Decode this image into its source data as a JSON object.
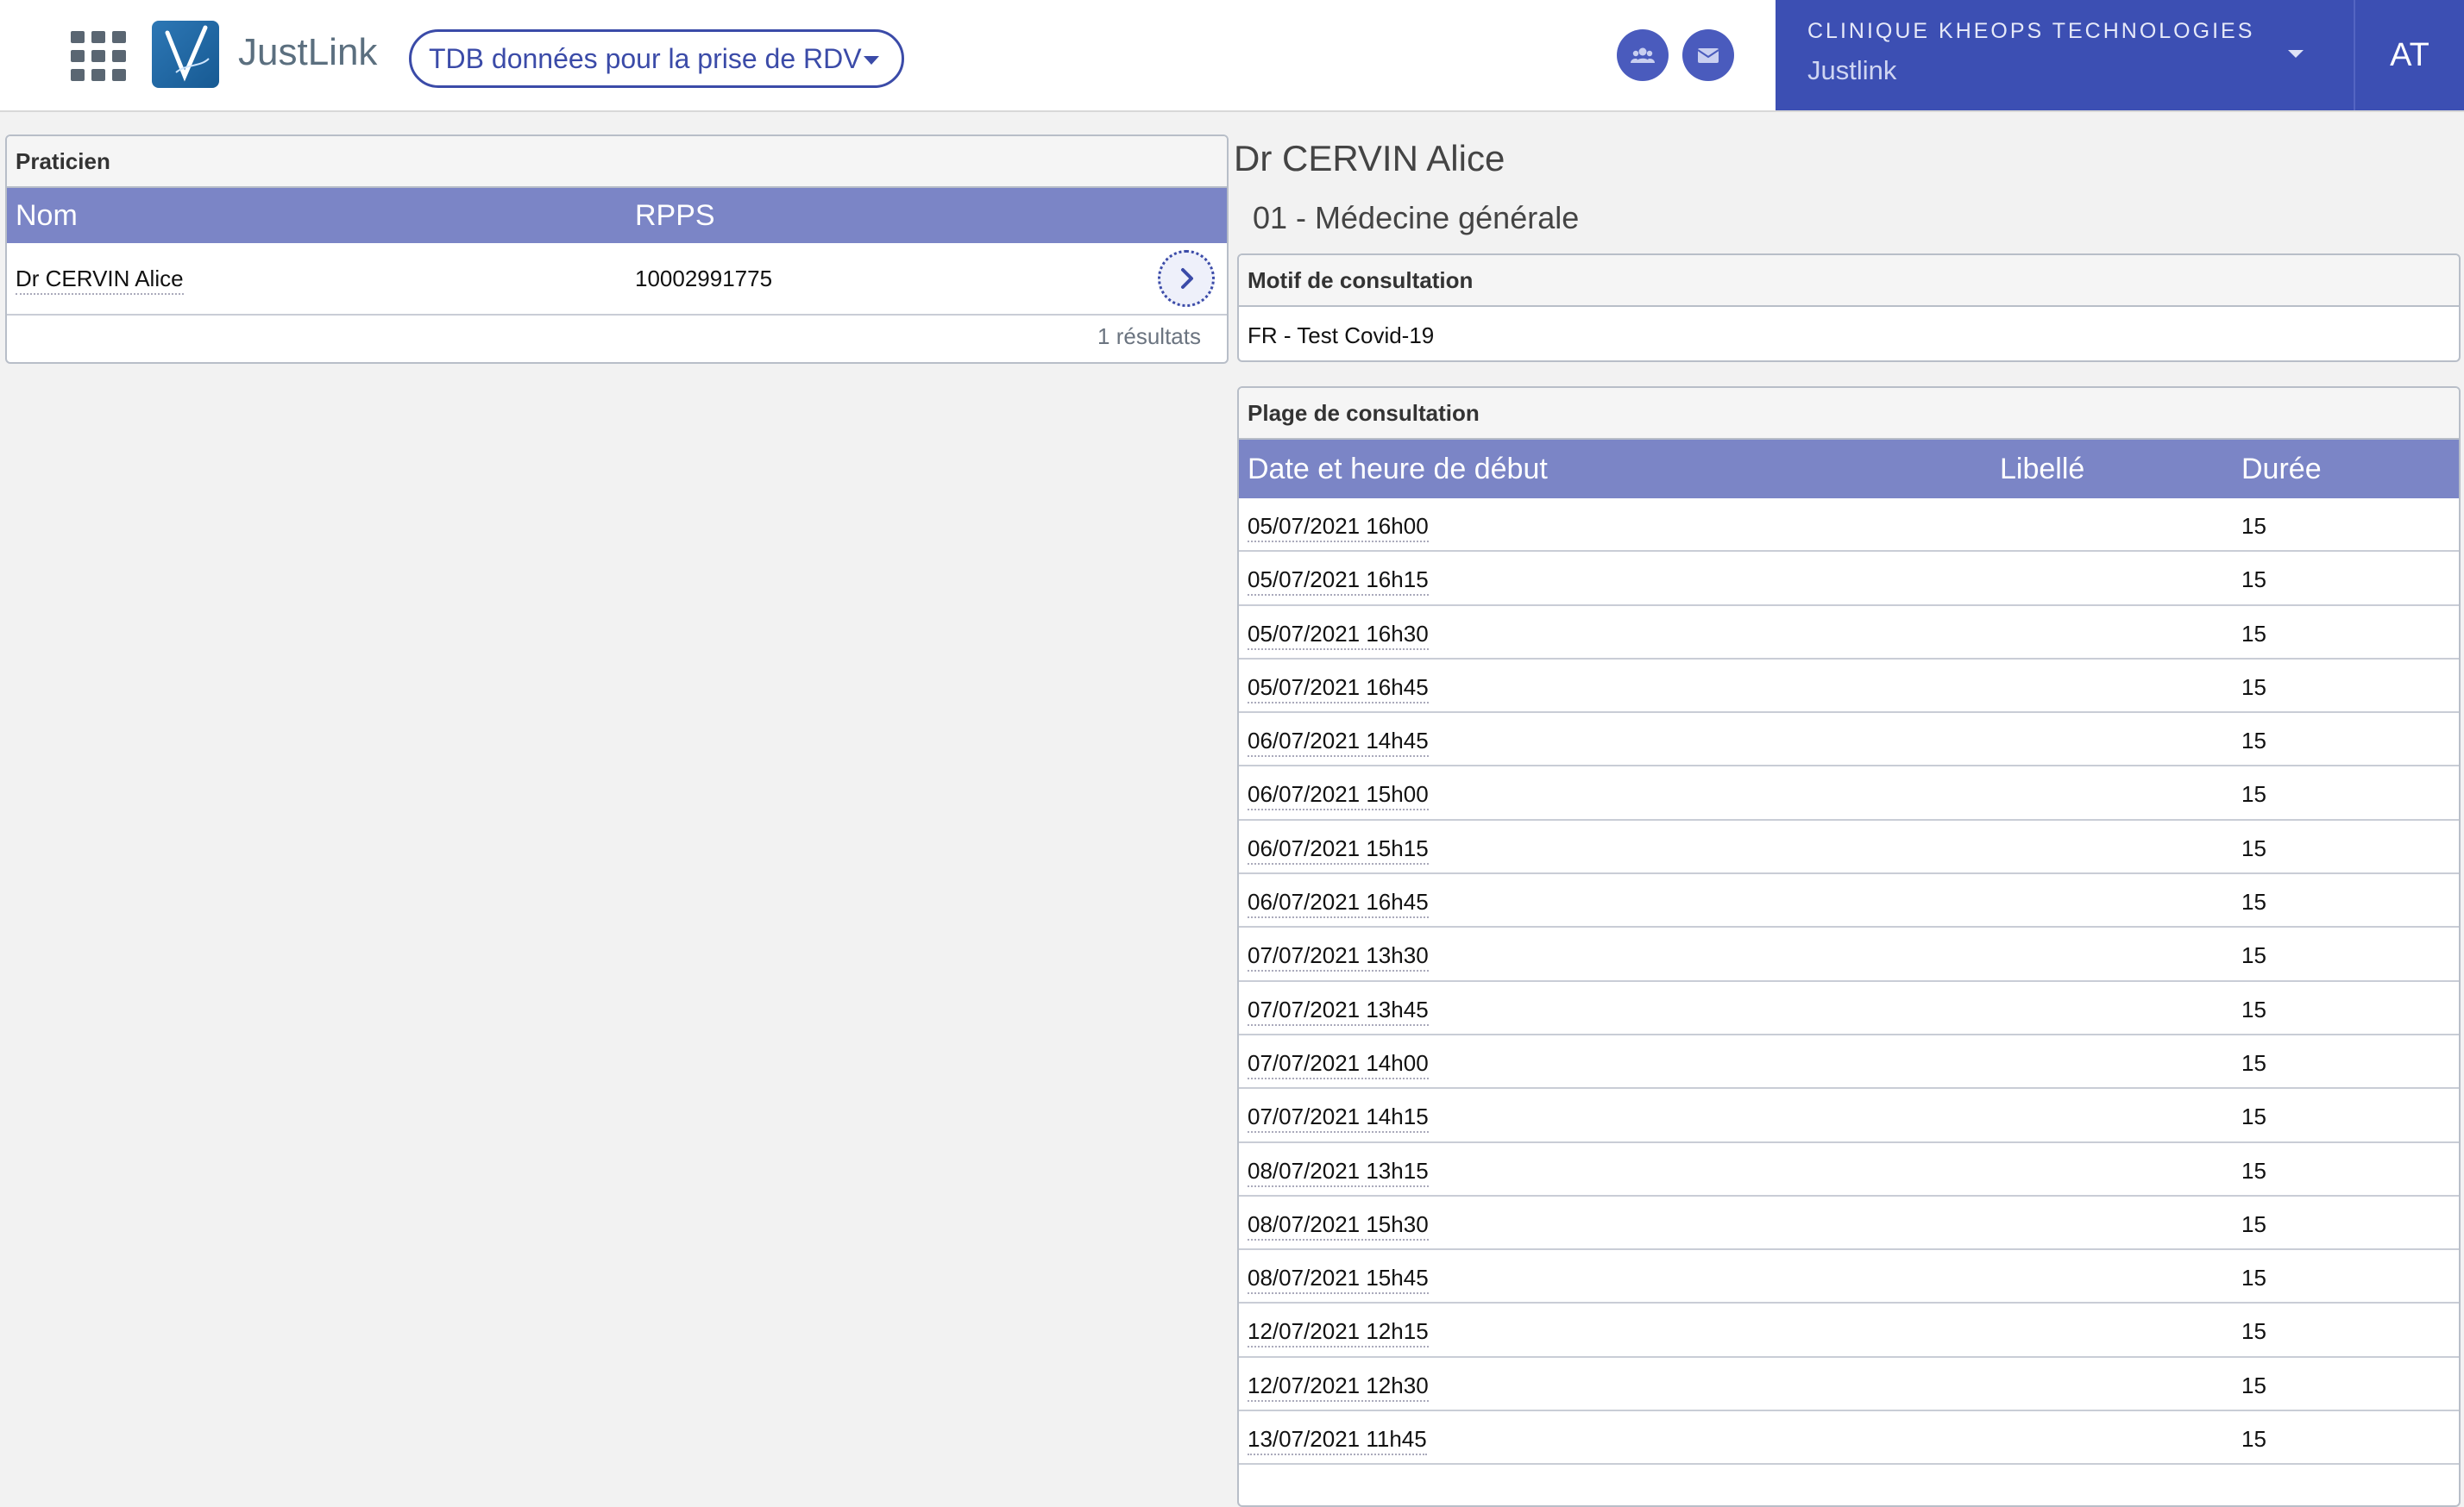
{
  "topbar": {
    "brand": "JustLink",
    "dashboard_select": "TDB données pour la prise de RDV",
    "org_name": "CLINIQUE KHEOPS TECHNOLOGIES",
    "org_sub": "Justlink",
    "avatar": "AT",
    "icons": [
      "apps-grid-icon",
      "users-icon",
      "mail-icon"
    ]
  },
  "praticien": {
    "title": "Praticien",
    "columns": [
      "Nom",
      "RPPS"
    ],
    "rows": [
      {
        "nom": "Dr CERVIN Alice",
        "rpps": "10002991775"
      }
    ],
    "results": "1 résultats"
  },
  "detail": {
    "doctor": "Dr CERVIN Alice",
    "specialty": "01 - Médecine générale",
    "motif_title": "Motif de consultation",
    "motif_value": "FR - Test Covid-19",
    "plage_title": "Plage de consultation",
    "plage_columns": [
      "Date et heure de début",
      "Libellé",
      "Durée"
    ],
    "plage_rows": [
      {
        "date": "05/07/2021 16h00",
        "libelle": "",
        "duree": "15"
      },
      {
        "date": "05/07/2021 16h15",
        "libelle": "",
        "duree": "15"
      },
      {
        "date": "05/07/2021 16h30",
        "libelle": "",
        "duree": "15"
      },
      {
        "date": "05/07/2021 16h45",
        "libelle": "",
        "duree": "15"
      },
      {
        "date": "06/07/2021 14h45",
        "libelle": "",
        "duree": "15"
      },
      {
        "date": "06/07/2021 15h00",
        "libelle": "",
        "duree": "15"
      },
      {
        "date": "06/07/2021 15h15",
        "libelle": "",
        "duree": "15"
      },
      {
        "date": "06/07/2021 16h45",
        "libelle": "",
        "duree": "15"
      },
      {
        "date": "07/07/2021 13h30",
        "libelle": "",
        "duree": "15"
      },
      {
        "date": "07/07/2021 13h45",
        "libelle": "",
        "duree": "15"
      },
      {
        "date": "07/07/2021 14h00",
        "libelle": "",
        "duree": "15"
      },
      {
        "date": "07/07/2021 14h15",
        "libelle": "",
        "duree": "15"
      },
      {
        "date": "08/07/2021 13h15",
        "libelle": "",
        "duree": "15"
      },
      {
        "date": "08/07/2021 15h30",
        "libelle": "",
        "duree": "15"
      },
      {
        "date": "08/07/2021 15h45",
        "libelle": "",
        "duree": "15"
      },
      {
        "date": "12/07/2021 12h15",
        "libelle": "",
        "duree": "15"
      },
      {
        "date": "12/07/2021 12h30",
        "libelle": "",
        "duree": "15"
      },
      {
        "date": "13/07/2021 11h45",
        "libelle": "",
        "duree": "15"
      }
    ]
  }
}
